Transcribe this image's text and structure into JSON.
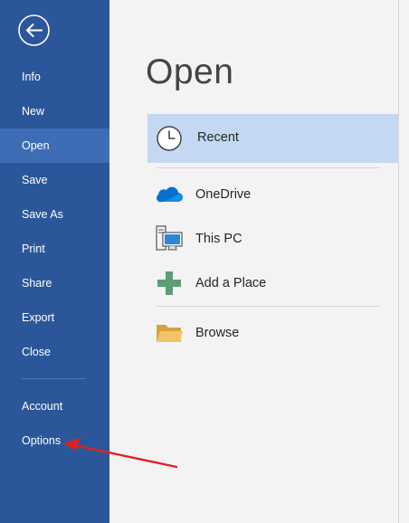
{
  "sidebar": {
    "items": [
      {
        "label": "Info"
      },
      {
        "label": "New"
      },
      {
        "label": "Open"
      },
      {
        "label": "Save"
      },
      {
        "label": "Save As"
      },
      {
        "label": "Print"
      },
      {
        "label": "Share"
      },
      {
        "label": "Export"
      },
      {
        "label": "Close"
      },
      {
        "label": "Account"
      },
      {
        "label": "Options"
      }
    ],
    "active": "Open",
    "back_icon": "back-arrow-icon"
  },
  "main": {
    "title": "Open",
    "locations": [
      {
        "label": "Recent",
        "icon": "clock-icon",
        "selected": true
      },
      {
        "label": "OneDrive",
        "icon": "cloud-icon"
      },
      {
        "label": "This PC",
        "icon": "computer-icon"
      },
      {
        "label": "Add a Place",
        "icon": "plus-icon"
      },
      {
        "label": "Browse",
        "icon": "folder-icon"
      }
    ]
  },
  "annotation": {
    "type": "red-arrow",
    "points_to": "Options",
    "color": "#e02020"
  },
  "colors": {
    "sidebar_bg": "#2b579a",
    "sidebar_active": "#3e6db5",
    "selected_row": "#c4d8f3",
    "main_bg": "#f3f3f3",
    "onedrive_blue": "#0a6ed1",
    "add_place_green": "#5e9c76",
    "folder_yellow": "#e8b74a"
  }
}
